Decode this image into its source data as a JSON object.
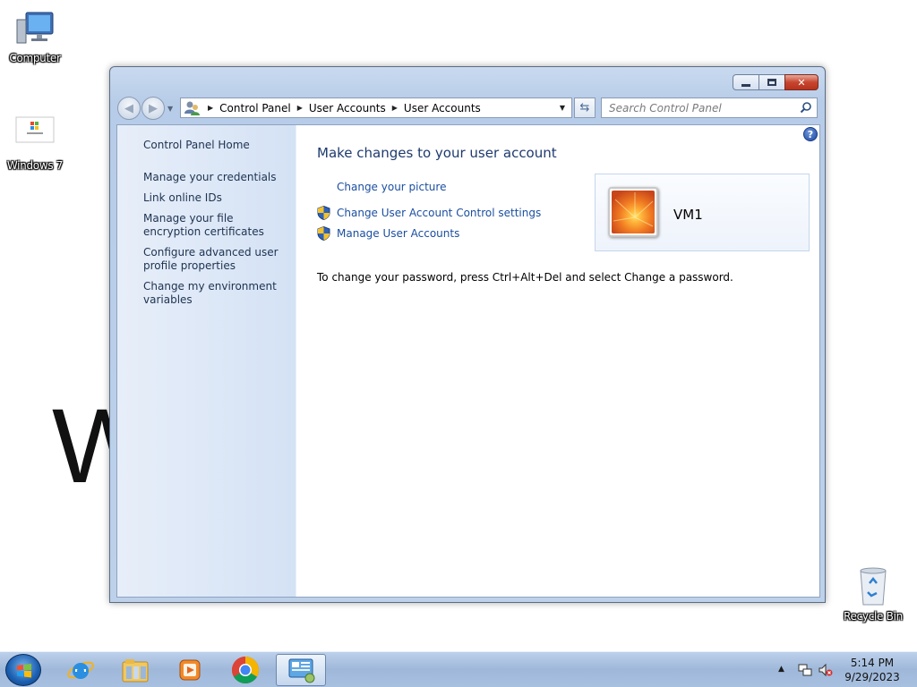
{
  "desktop": {
    "watermark_text": "W",
    "icons": [
      {
        "label": "Computer",
        "icon": "computer-icon"
      },
      {
        "label": "Windows 7",
        "icon": "windows7-file-icon"
      },
      {
        "label": "Recycle Bin",
        "icon": "recycle-bin-icon"
      }
    ]
  },
  "window": {
    "caption_buttons": [
      "minimize",
      "maximize",
      "close"
    ],
    "address": {
      "crumbs": [
        "Control Panel",
        "User Accounts",
        "User Accounts"
      ],
      "icon": "user-accounts-icon"
    },
    "search": {
      "placeholder": "Search Control Panel"
    },
    "left_pane": {
      "home": "Control Panel Home",
      "links": [
        "Manage your credentials",
        "Link online IDs",
        "Manage your file encryption certificates",
        "Configure advanced user profile properties",
        "Change my environment variables"
      ]
    },
    "main": {
      "title": "Make changes to your user account",
      "tasks": [
        {
          "label": "Change your picture",
          "shield": false
        },
        {
          "label": "Change User Account Control settings",
          "shield": true
        },
        {
          "label": "Manage User Accounts",
          "shield": true
        }
      ],
      "info": "To change your password, press Ctrl+Alt+Del and select Change a password.",
      "account": {
        "name": "VM1"
      }
    }
  },
  "taskbar": {
    "pinned": [
      "internet-explorer-icon",
      "windows-explorer-icon",
      "media-player-icon",
      "chrome-icon",
      "control-panel-icon"
    ],
    "active": "control-panel-icon",
    "clock": {
      "time": "5:14 PM",
      "date": "9/29/2023"
    }
  },
  "colors": {
    "link": "#1b4fa0",
    "title": "#1e3a6e",
    "left_pane": "#dde8f7",
    "taskbar": "#a8c0e0"
  }
}
